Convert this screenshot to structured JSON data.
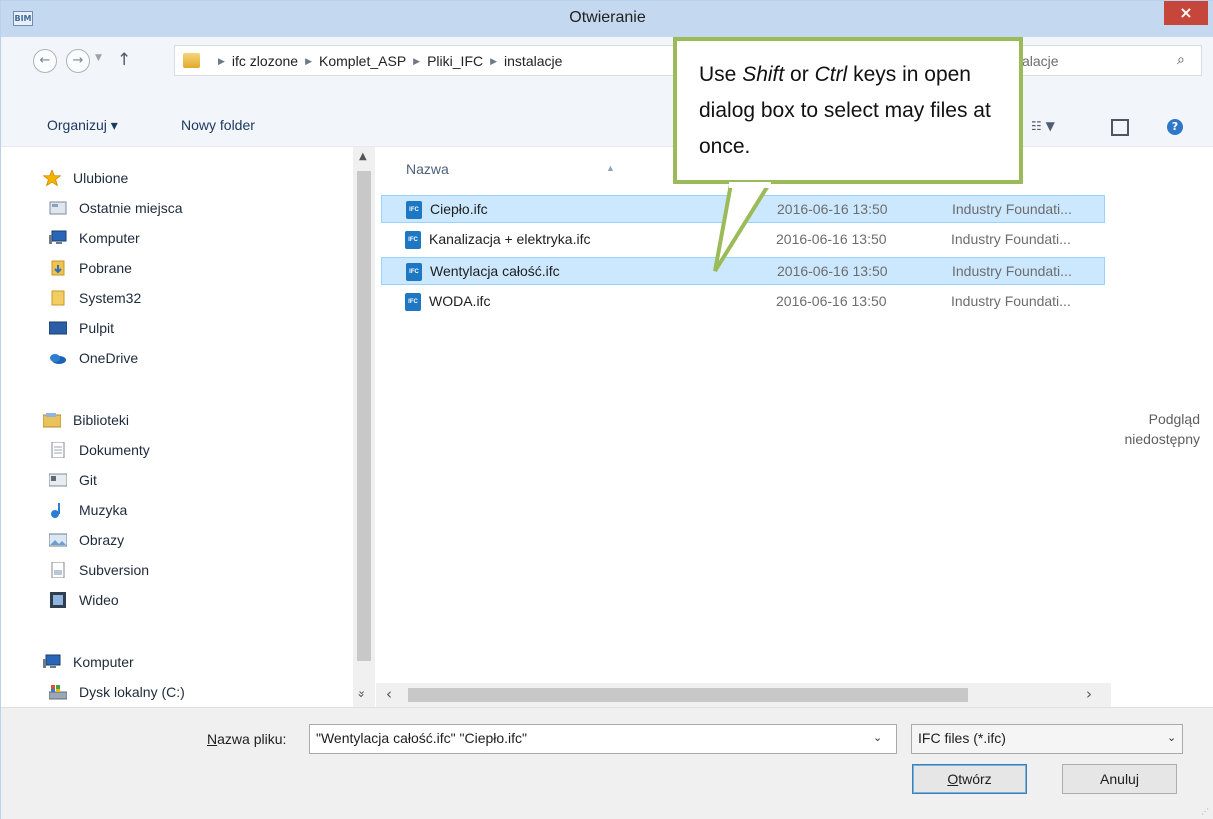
{
  "window": {
    "title": "Otwieranie",
    "close_glyph": "×",
    "app_icon": "BIM"
  },
  "nav": {
    "back_icon": "←",
    "forward_icon": "→",
    "up_icon": "↑",
    "breadcrumb": [
      "ifc zlozone",
      "Komplet_ASP",
      "Pliki_IFC",
      "instalacje"
    ],
    "search_placeholder": "alacje",
    "search_icon": "⌕"
  },
  "toolbar": {
    "organize_label": "Organizuj ▾",
    "new_folder_label": "Nowy folder",
    "help_glyph": "?"
  },
  "sidebar": {
    "favorites": {
      "label": "Ulubione",
      "icon": "star-icon"
    },
    "favorites_items": [
      {
        "label": "Ostatnie miejsca",
        "icon": "recent-places-icon"
      },
      {
        "label": "Komputer",
        "icon": "computer-icon"
      },
      {
        "label": "Pobrane",
        "icon": "downloads-icon"
      },
      {
        "label": "System32",
        "icon": "folder-icon"
      },
      {
        "label": "Pulpit",
        "icon": "desktop-icon"
      },
      {
        "label": "OneDrive",
        "icon": "onedrive-icon"
      }
    ],
    "libraries": {
      "label": "Biblioteki",
      "icon": "libraries-icon"
    },
    "library_items": [
      {
        "label": "Dokumenty",
        "icon": "documents-icon"
      },
      {
        "label": "Git",
        "icon": "git-icon"
      },
      {
        "label": "Muzyka",
        "icon": "music-icon"
      },
      {
        "label": "Obrazy",
        "icon": "pictures-icon"
      },
      {
        "label": "Subversion",
        "icon": "subversion-icon"
      },
      {
        "label": "Wideo",
        "icon": "video-icon"
      }
    ],
    "computer": {
      "label": "Komputer",
      "icon": "computer-icon"
    },
    "computer_items": [
      {
        "label": "Dysk lokalny (C:)",
        "icon": "drive-icon"
      }
    ]
  },
  "filelist": {
    "column_name": "Nazwa",
    "files": [
      {
        "name": "Ciepło.ifc",
        "date": "2016-06-16 13:50",
        "type": "Industry Foundati...",
        "selected": true
      },
      {
        "name": "Kanalizacja + elektryka.ifc",
        "date": "2016-06-16 13:50",
        "type": "Industry Foundati...",
        "selected": false
      },
      {
        "name": "Wentylacja całość.ifc",
        "date": "2016-06-16 13:50",
        "type": "Industry Foundati...",
        "selected": true
      },
      {
        "name": "WODA.ifc",
        "date": "2016-06-16 13:50",
        "type": "Industry Foundati...",
        "selected": false
      }
    ],
    "file_icon_text": "IFC"
  },
  "preview": {
    "line1": "Podgląd",
    "line2": "niedostępny"
  },
  "bottom": {
    "filename_label_u": "N",
    "filename_label_rest": "azwa pliku:",
    "filename_value": "\"Wentylacja całość.ifc\" \"Ciepło.ifc\"",
    "filetype_value": "IFC files (*.ifc)",
    "open_label_u": "O",
    "open_label_rest": "twórz",
    "cancel_label": "Anuluj"
  },
  "callout": {
    "t1": "Use ",
    "t2": "Shift",
    "t3": " or ",
    "t4": "Ctrl",
    "t5": " keys in open dialog box to select may files at once."
  },
  "colors": {
    "title_bar": "#c4d9ef",
    "close": "#c7463b",
    "selection": "#cce8ff",
    "callout_border": "#9bbb59"
  }
}
